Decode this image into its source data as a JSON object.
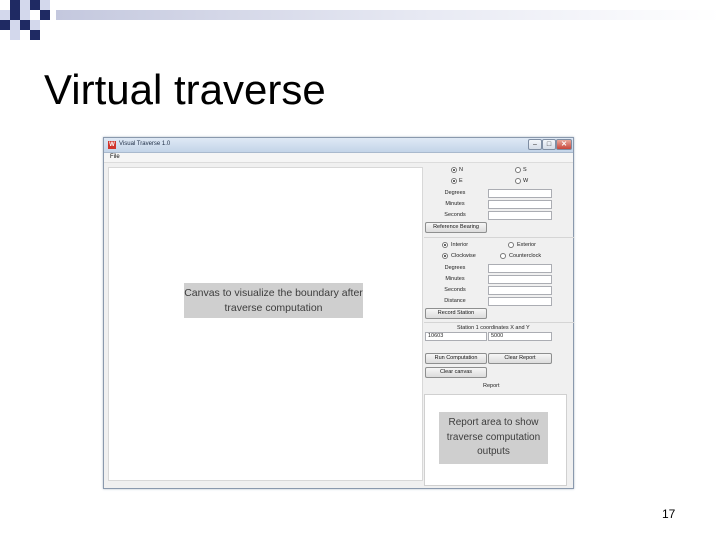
{
  "slide": {
    "title": "Virtual traverse",
    "page_number": "17"
  },
  "window": {
    "app_icon_text": "W",
    "title": "Visual Traverse 1.0",
    "minimize": "–",
    "maximize": "□",
    "close": "✕",
    "menu": {
      "file": "File"
    }
  },
  "canvas": {
    "label_line1": "Canvas to visualize the boundary after",
    "label_line2": "traverse computation"
  },
  "reference": {
    "radios": [
      {
        "label": "N",
        "selected": true
      },
      {
        "label": "S",
        "selected": false
      },
      {
        "label": "E",
        "selected": true
      },
      {
        "label": "W",
        "selected": false
      }
    ],
    "fields": [
      {
        "label": "Degrees",
        "value": ""
      },
      {
        "label": "Minutes",
        "value": ""
      },
      {
        "label": "Seconds",
        "value": ""
      }
    ],
    "button": "Reference Bearing"
  },
  "station": {
    "radios": [
      {
        "label": "Interior",
        "selected": true
      },
      {
        "label": "Exterior",
        "selected": false
      },
      {
        "label": "Clockwise",
        "selected": true
      },
      {
        "label": "Counterclock",
        "selected": false
      }
    ],
    "fields": [
      {
        "label": "Degrees",
        "value": ""
      },
      {
        "label": "Minutes",
        "value": ""
      },
      {
        "label": "Seconds",
        "value": ""
      },
      {
        "label": "Distance",
        "value": ""
      }
    ],
    "button": "Record Station"
  },
  "coordinates": {
    "label": "Station 1 coordinates X and Y",
    "x_value": "10603",
    "y_value": "5000"
  },
  "actions": {
    "run": "Run Computation",
    "clear_report": "Clear Report",
    "clear_canvas": "Clear canvas"
  },
  "report": {
    "heading": "Report",
    "label_line1": "Report area to show",
    "label_line2": "traverse computation",
    "label_line3": "outputs"
  },
  "colors": {
    "accent_dark": "#1f2a63",
    "accent_light": "#d3d8ec",
    "placeholder_gray": "#cfcfcf"
  }
}
